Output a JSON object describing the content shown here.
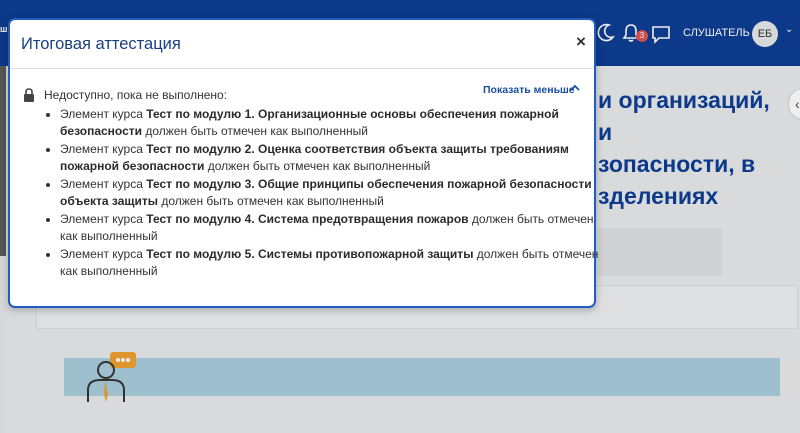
{
  "navbar": {
    "left_fragment": "ш",
    "notifications_count": "3",
    "user_role": "СЛУШАТЕЛЬ",
    "avatar_initials": "ЕБ",
    "caret": "⌄"
  },
  "background": {
    "course_title": "и организаций,\nи\nзопасности, в\nзделениях"
  },
  "modal": {
    "title": "Итоговая аттестация",
    "close_label": "×",
    "restriction_header": "Недоступно, пока не выполнено:",
    "show_less_label": "Показать меньше",
    "conditions": [
      {
        "prefix": "Элемент курса ",
        "name": "Тест по модулю 1. Организационные основы обеспечения пожарной безопасности",
        "suffix": " должен быть отмечен как выполненный"
      },
      {
        "prefix": "Элемент курса ",
        "name": "Тест по модулю 2. Оценка соответствия объекта защиты требованиям пожарной безопасности",
        "suffix": " должен быть отмечен как выполненный"
      },
      {
        "prefix": "Элемент курса ",
        "name": "Тест по модулю 3. Общие принципы обеспечения пожарной безопасности объекта защиты",
        "suffix": " должен быть отмечен как выполненный"
      },
      {
        "prefix": "Элемент курса ",
        "name": "Тест по модулю 4. Система предотвращения пожаров",
        "suffix": " должен быть отмечен как выполненный"
      },
      {
        "prefix": "Элемент курса ",
        "name": "Тест по модулю 5. Системы противопожарной защиты",
        "suffix": " должен быть отмечен как выполненный"
      }
    ]
  },
  "colors": {
    "navbar": "#0b3b93",
    "modal_border": "#1f5ec0",
    "title_text": "#1a3f7e",
    "link": "#1a4fa0",
    "blue_band": "#a9ccdc"
  }
}
